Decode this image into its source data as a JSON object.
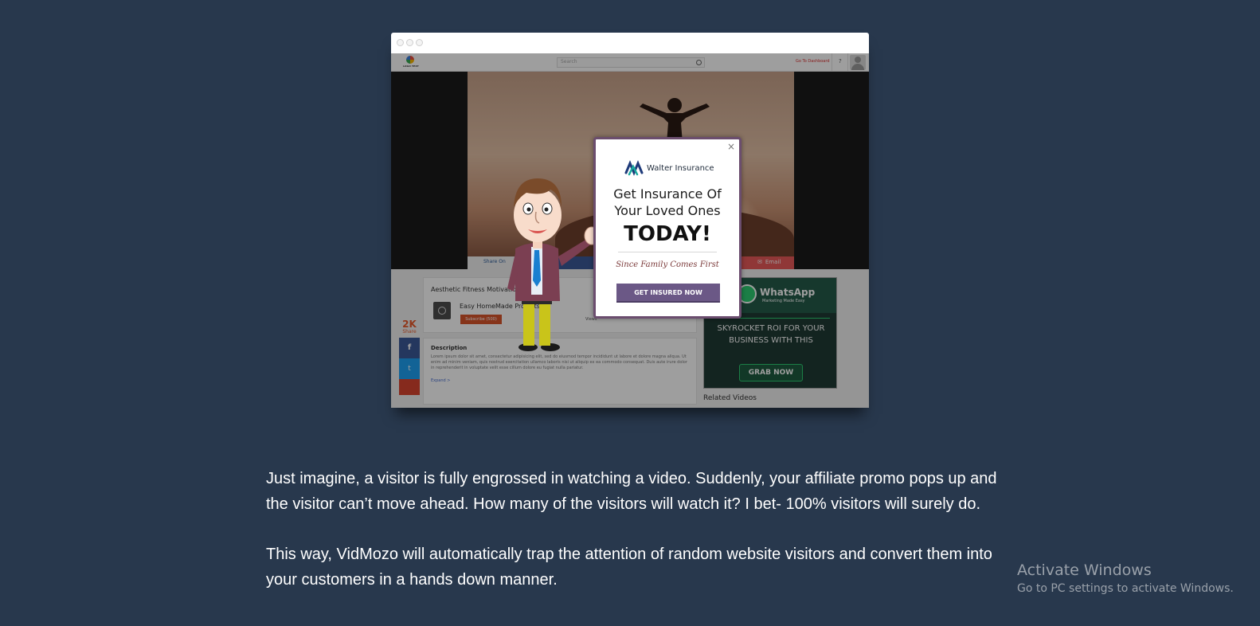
{
  "site": {
    "logo_text": "LOGO TEXT",
    "search_placeholder": "Search",
    "dashboard_link": "Go To Dashboard",
    "help_label": "?"
  },
  "video": {
    "share_on": "Share On",
    "email_label": "Email"
  },
  "left_share": {
    "count": "2K",
    "label": "Share",
    "fb": "f",
    "tw": "t"
  },
  "card": {
    "title": "Aesthetic Fitness Motivation",
    "channel": "Easy HomeMade Projects",
    "subscribe": "Subscribe (500)",
    "views": "Views"
  },
  "description": {
    "title": "Description",
    "text": "Lorem ipsum dolor sit amet, consectetur adipisicing elit, sed do eiusmod tempor incididunt ut labore et dolore magna aliqua. Ut enim ad minim veniam, quis nostrud exercitation ullamco laboris nisi ut aliquip ex ea commodo consequat. Duis aute irure dolor in reprehenderit in voluptate velit esse cillum dolore eu fugiat nulla pariatur.",
    "expand": "Expand >"
  },
  "ad": {
    "brand": "WhatsApp",
    "tagline": "Marketing Made Easy",
    "text": "SKYROCKET ROI FOR YOUR BUSINESS WITH THIS",
    "button": "GRAB NOW"
  },
  "related": "Related Videos",
  "popup": {
    "close": "×",
    "brand": "Walter Insurance",
    "headline_1": "Get Insurance Of",
    "headline_2": "Your Loved Ones",
    "today": "TODAY!",
    "tagline": "Since Family Comes First",
    "cta": "GET INSURED NOW"
  },
  "article": {
    "p1": "Just imagine, a visitor is fully engrossed in watching a video. Suddenly, your affiliate promo pops up and the visitor can’t move ahead. How many of the visitors will watch it? I bet- 100% visitors will surely do.",
    "p2": "This way, VidMozo will automatically trap the attention of random website visitors and convert them into your customers in a hands down manner."
  },
  "watermark": {
    "title": "Activate Windows",
    "subtitle": "Go to PC settings to activate Windows."
  },
  "colors": {
    "page_bg": "#28384d",
    "popup_border": "#6b4d6e",
    "cta_bg": "#6b5886",
    "subscribe_bg": "#d9542a"
  }
}
